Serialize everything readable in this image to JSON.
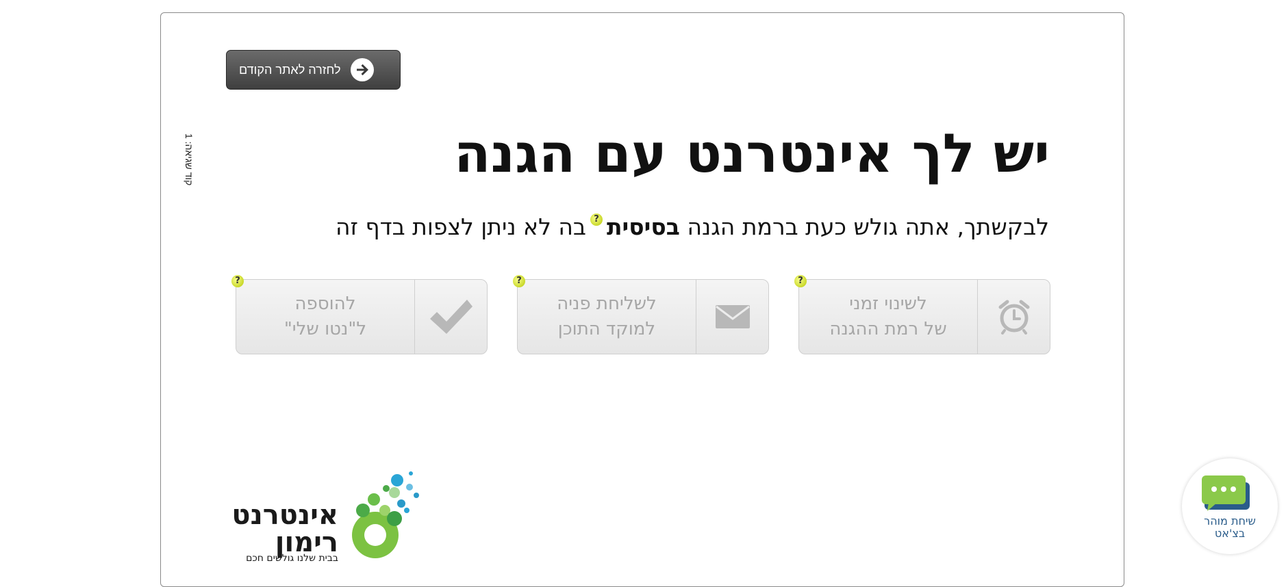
{
  "back_button": {
    "label": "לחזרה לאתר הקודם",
    "icon": "arrow-right-icon"
  },
  "side_code": "קוד שגיאה: 1",
  "title": "יש לך אינטרנט עם הגנה",
  "subtitle": {
    "prefix": "לבקשתך, אתה גולש כעת ברמת הגנה",
    "level": "בסיסית",
    "suffix": "בה לא ניתן לצפות בדף זה"
  },
  "help_mark": "?",
  "actions": [
    {
      "line1": "לשינוי זמני",
      "line2": "של רמת ההגנה",
      "icon": "alarm-clock-icon"
    },
    {
      "line1": "לשליחת פניה",
      "line2": "למוקד התוכן",
      "icon": "envelope-icon"
    },
    {
      "line1": "להוספה",
      "line2": "ל\"נטו שלי\"",
      "icon": "checkmark-icon"
    }
  ],
  "logo": {
    "name_line1": "אינטרנט",
    "name_line2": "רימון",
    "tagline": "בבית שלנו גולשים חכם"
  },
  "chat_widget": {
    "line1": "שיחת מוהר",
    "line2": "בצ'אט"
  },
  "colors": {
    "button_dark": "#4d4d4d",
    "action_text": "#a6a6a6",
    "help_yellow": "#d4e23a",
    "logo_green": "#7cc242",
    "chat_green": "#8bc94a",
    "chat_text": "#2a5c8a"
  }
}
